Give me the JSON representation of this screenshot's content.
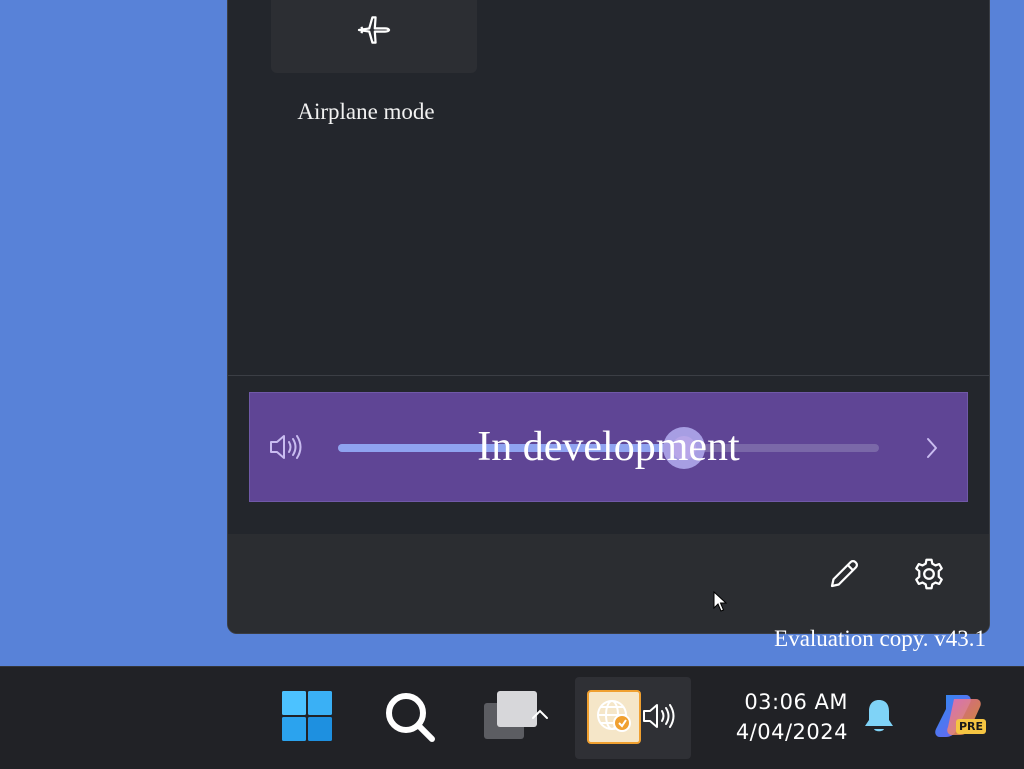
{
  "quick_settings": {
    "tiles": [
      {
        "label": "Airplane mode",
        "icon": "airplane-icon"
      }
    ],
    "volume": {
      "overlay_text": "In development",
      "level_percent": 64,
      "icon": "speaker-icon"
    },
    "footer": {
      "edit_icon": "pencil-icon",
      "settings_icon": "gear-icon"
    }
  },
  "watermark": "Evaluation copy. v43.1",
  "taskbar": {
    "clock_time": "03:06 AM",
    "clock_date": "4/04/2024",
    "icons": [
      "windows-start-icon",
      "search-icon",
      "task-view-icon",
      "chevron-up-icon",
      "network-globe-icon",
      "speaker-icon",
      "bell-icon",
      "copilot-icon"
    ],
    "copilot_badge": "PRE"
  },
  "colors": {
    "desktop": "#5882d8",
    "panel": "#23262c",
    "volume_row": "#5f4595",
    "accent": "#8fa3f0"
  }
}
